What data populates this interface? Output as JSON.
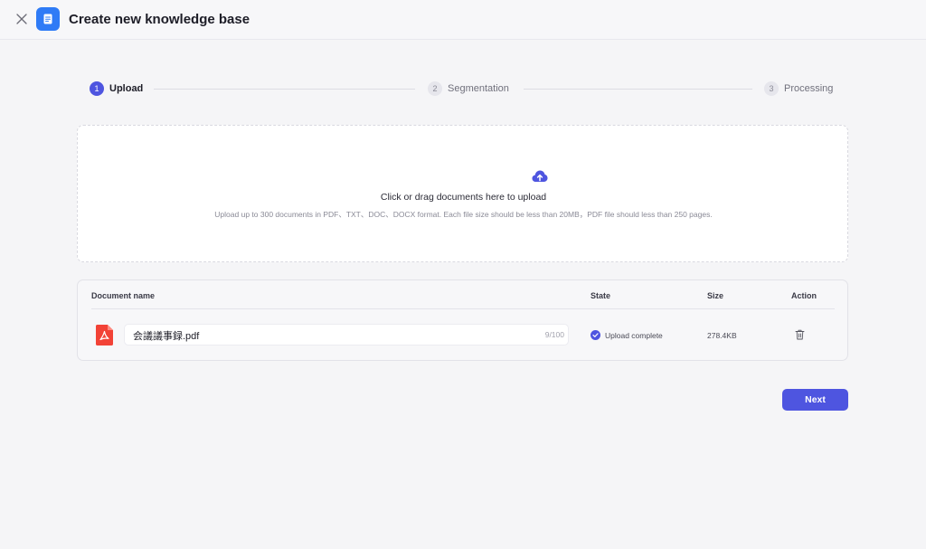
{
  "header": {
    "title": "Create new knowledge base",
    "close_icon": "close-icon",
    "app_icon": "document-icon",
    "accent": "#2f7bf6"
  },
  "stepper": {
    "steps": [
      {
        "number": "1",
        "label": "Upload",
        "active": true
      },
      {
        "number": "2",
        "label": "Segmentation",
        "active": false
      },
      {
        "number": "3",
        "label": "Processing",
        "active": false
      }
    ],
    "active_color": "#4e55e0"
  },
  "upload": {
    "icon": "cloud-upload-icon",
    "title": "Click or drag documents here to upload",
    "hint": "Upload up to 300 documents in PDF、TXT、DOC、DOCX format. Each file size should be less than 20MB，PDF file should less than 250 pages."
  },
  "table": {
    "headers": {
      "name": "Document name",
      "state": "State",
      "size": "Size",
      "action": "Action"
    },
    "rows": [
      {
        "icon": "pdf-file-icon",
        "name": "会議議事録.pdf",
        "char_count": "9/100",
        "state": "Upload complete",
        "state_icon": "check-circle-icon",
        "size": "278.4KB",
        "action_icon": "trash-icon"
      }
    ]
  },
  "footer": {
    "next_label": "Next",
    "button_color": "#4e55e0"
  }
}
